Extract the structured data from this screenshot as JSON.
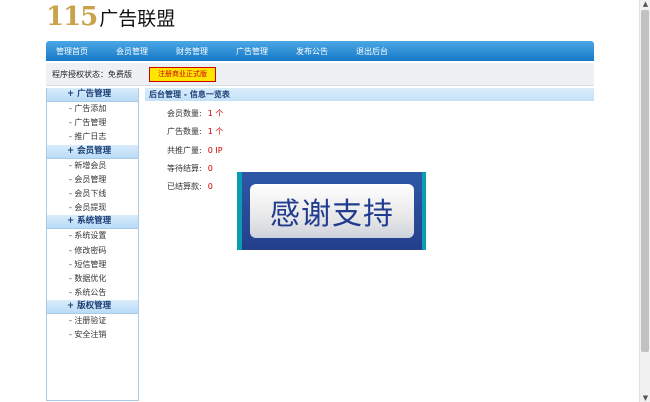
{
  "header": {
    "logo_number": "115",
    "logo_text": "广告联盟"
  },
  "nav": [
    "管理首页",
    "会员管理",
    "财务管理",
    "广告管理",
    "发布公告",
    "退出后台"
  ],
  "status": {
    "license_label": "程序授权状态：免费版",
    "upgrade_label": "注册商业正式版"
  },
  "sidebar": [
    {
      "title": "+ 广告管理",
      "items": [
        "- 广告添加",
        "- 广告管理",
        "- 推广日志"
      ]
    },
    {
      "title": "+ 会员管理",
      "items": [
        "- 新增会员",
        "- 会员管理",
        "- 会员下线",
        "- 会员提现"
      ]
    },
    {
      "title": "+ 系统管理",
      "items": [
        "- 系统设置",
        "- 修改密码",
        "- 短信管理",
        "- 数据优化",
        "- 系统公告"
      ]
    },
    {
      "title": "+ 版权管理",
      "items": [
        "- 注册验证",
        "- 安全注销"
      ]
    }
  ],
  "content": {
    "title": "后台管理 - 信息一览表",
    "stats": [
      {
        "label": "会员数量:",
        "value": "1 个"
      },
      {
        "label": "广告数量:",
        "value": "1 个"
      },
      {
        "label": "共推广量:",
        "value": "0 IP"
      },
      {
        "label": "等待结算:",
        "value": "0"
      },
      {
        "label": "已结算款:",
        "value": "0"
      }
    ],
    "banner_text": "感谢支持"
  },
  "scrollbar": {
    "up_icon": "▲",
    "down_icon": "▼"
  }
}
